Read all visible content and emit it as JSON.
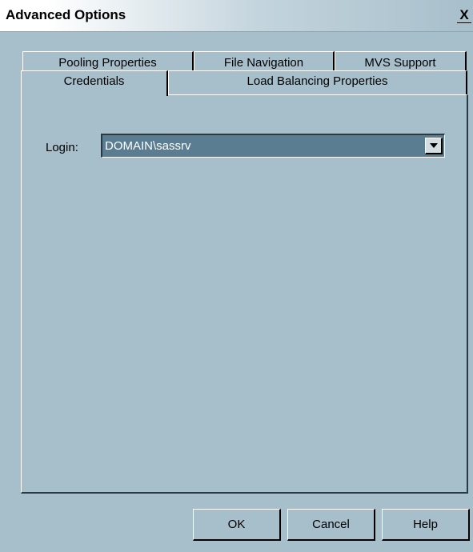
{
  "window": {
    "title": "Advanced Options",
    "close_glyph": "X"
  },
  "tabs": {
    "back_row": [
      "Pooling Properties",
      "File Navigation",
      "MVS Support"
    ],
    "front_row": [
      "Credentials",
      "Load Balancing Properties"
    ],
    "active": "Credentials"
  },
  "form": {
    "login_label": "Login:",
    "login_value": "DOMAIN\\sassrv"
  },
  "buttons": {
    "ok": "OK",
    "cancel": "Cancel",
    "help": "Help"
  },
  "colors": {
    "background": "#a7bfcb",
    "combo_fill": "#5a7d91"
  }
}
